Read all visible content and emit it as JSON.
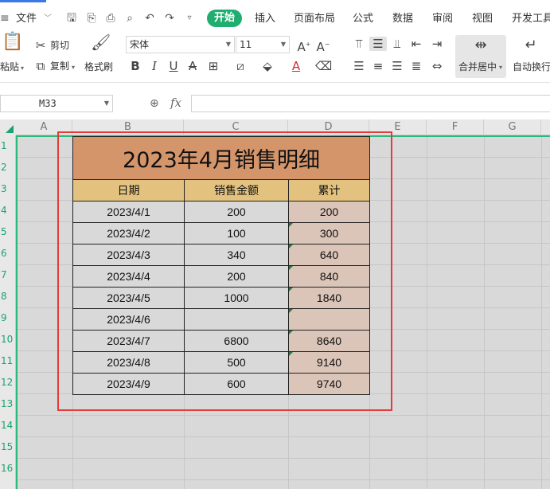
{
  "menu": {
    "file": "文件",
    "tabs": [
      "开始",
      "插入",
      "页面布局",
      "公式",
      "数据",
      "审阅",
      "视图",
      "开发工具"
    ]
  },
  "ribbon": {
    "paste": "粘贴",
    "cut": "剪切",
    "copy": "复制",
    "format_painter": "格式刷",
    "font_name": "宋体",
    "font_size": "11",
    "merge_center": "合并居中",
    "wrap_text": "自动换行"
  },
  "formula_bar": {
    "name_box": "M33",
    "fx": "fx",
    "value": ""
  },
  "sheet": {
    "columns": [
      "A",
      "B",
      "C",
      "D",
      "E",
      "F",
      "G"
    ],
    "rows": [
      "1",
      "2",
      "3",
      "4",
      "5",
      "6",
      "7",
      "8",
      "9",
      "10",
      "11",
      "12",
      "13",
      "14",
      "15",
      "16"
    ]
  },
  "table": {
    "title": "2023年4月销售明细",
    "headers": [
      "日期",
      "销售金额",
      "累计"
    ],
    "rows": [
      {
        "date": "2023/4/1",
        "amount": "200",
        "total": "200"
      },
      {
        "date": "2023/4/2",
        "amount": "100",
        "total": "300"
      },
      {
        "date": "2023/4/3",
        "amount": "340",
        "total": "640"
      },
      {
        "date": "2023/4/4",
        "amount": "200",
        "total": "840"
      },
      {
        "date": "2023/4/5",
        "amount": "1000",
        "total": "1840"
      },
      {
        "date": "2023/4/6",
        "amount": "",
        "total": ""
      },
      {
        "date": "2023/4/7",
        "amount": "6800",
        "total": "8640"
      },
      {
        "date": "2023/4/8",
        "amount": "500",
        "total": "9140"
      },
      {
        "date": "2023/4/9",
        "amount": "600",
        "total": "9740"
      }
    ]
  },
  "colors": {
    "accent_green": "#1fae6f",
    "title_fill": "#d4956b",
    "header_fill": "#e2c27e",
    "total_fill": "#dbc4b8",
    "highlight_frame": "#e43b3b"
  }
}
